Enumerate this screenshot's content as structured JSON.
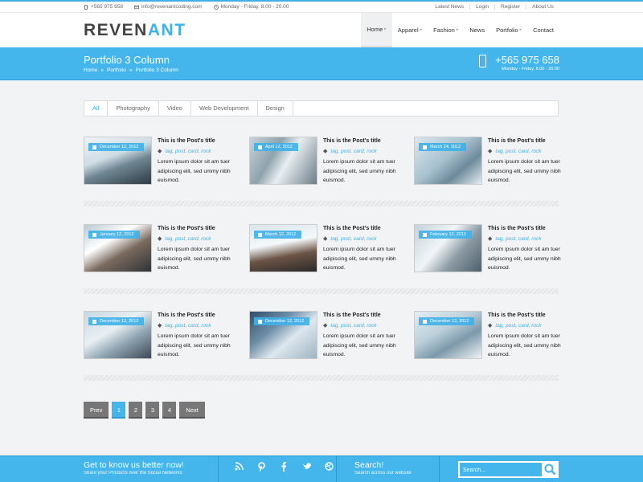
{
  "topbar": {
    "phone": "+565 975 658",
    "email": "info@revenantcoding.com",
    "hours": "Monday - Friday, 8.00 - 20.00",
    "links": [
      "Latest News",
      "Login",
      "Register",
      "About Us"
    ]
  },
  "header": {
    "logo_part1": "REVEN",
    "logo_part2": "ANT",
    "nav": [
      {
        "label": "Home",
        "caret": "▸"
      },
      {
        "label": "Apparel",
        "caret": "▸"
      },
      {
        "label": "Fashion",
        "caret": "▸"
      },
      {
        "label": "News",
        "caret": ""
      },
      {
        "label": "Portfolio",
        "caret": "▸"
      },
      {
        "label": "Contact",
        "caret": ""
      }
    ]
  },
  "band": {
    "title": "Portfolio 3 Column",
    "breadcrumb": [
      "Home",
      "»",
      "Portfolio",
      "»",
      "Portfolio 3 Column"
    ],
    "phone": "+565 975 658",
    "hours": "Monday - Friday, 8.00 - 20.00"
  },
  "filters": [
    "All",
    "Photography",
    "Video",
    "Web Development",
    "Design"
  ],
  "posts": [
    {
      "date": "December 12, 2012",
      "title": "This is the Post's title",
      "tags": "tag, post, card, rock",
      "excerpt": "Lorem ipsum dolor sit am tuer adipiscing elit, sed ummy nibh euismod."
    },
    {
      "date": "April 12, 2012",
      "title": "This is the Post's title",
      "tags": "tag, post, card, rock",
      "excerpt": "Lorem ipsum dolor sit am tuer adipiscing elit, sed ummy nibh euismod."
    },
    {
      "date": "March 24, 2012",
      "title": "This is the Post's title",
      "tags": "tag, post, card, rock",
      "excerpt": "Lorem ipsum dolor sit am tuer adipiscing elit, sed ummy nibh euismod."
    },
    {
      "date": "January 12, 2012",
      "title": "This is the Post's title",
      "tags": "tag, post, card, rock",
      "excerpt": "Lorem ipsum dolor sit am tuer adipiscing elit, sed ummy nibh euismod."
    },
    {
      "date": "March 12, 2012",
      "title": "This is the Post's title",
      "tags": "tag, post, card, rock",
      "excerpt": "Lorem ipsum dolor sit am tuer adipiscing elit, sed ummy nibh euismod."
    },
    {
      "date": "February 12, 2012",
      "title": "This is the Post's title",
      "tags": "tag, post, card, rock",
      "excerpt": "Lorem ipsum dolor sit am tuer adipiscing elit, sed ummy nibh euismod."
    },
    {
      "date": "December 12, 2012",
      "title": "This is the Post's title",
      "tags": "tag, post, card, rock",
      "excerpt": "Lorem ipsum dolor sit am tuer adipiscing elit, sed ummy nibh euismod."
    },
    {
      "date": "December 12, 2012",
      "title": "This is the Post's title",
      "tags": "tag, post, card, rock",
      "excerpt": "Lorem ipsum dolor sit am tuer adipiscing elit, sed ummy nibh euismod."
    },
    {
      "date": "December 12, 2012",
      "title": "This is the Post's title",
      "tags": "tag, post, card, rock",
      "excerpt": "Lorem ipsum dolor sit am tuer adipiscing elit, sed ummy nibh euismod."
    }
  ],
  "pagination": {
    "prev": "Prev",
    "pages": [
      "1",
      "2",
      "3",
      "4"
    ],
    "next": "Next",
    "current": "1"
  },
  "footer": {
    "know": "Get to know us better now!",
    "share": "Share your Products over the Social Networks",
    "social_icons": [
      "rss-icon",
      "pinterest-icon",
      "facebook-icon",
      "twitter-icon",
      "dribbble-icon"
    ],
    "search_heading": "Search!",
    "search_sub": "Search across our website",
    "search_placeholder": "Search..."
  },
  "colors": {
    "accent": "#45b6ec",
    "dark_accent": "#2d9bd2",
    "pager_gray": "#777777"
  }
}
